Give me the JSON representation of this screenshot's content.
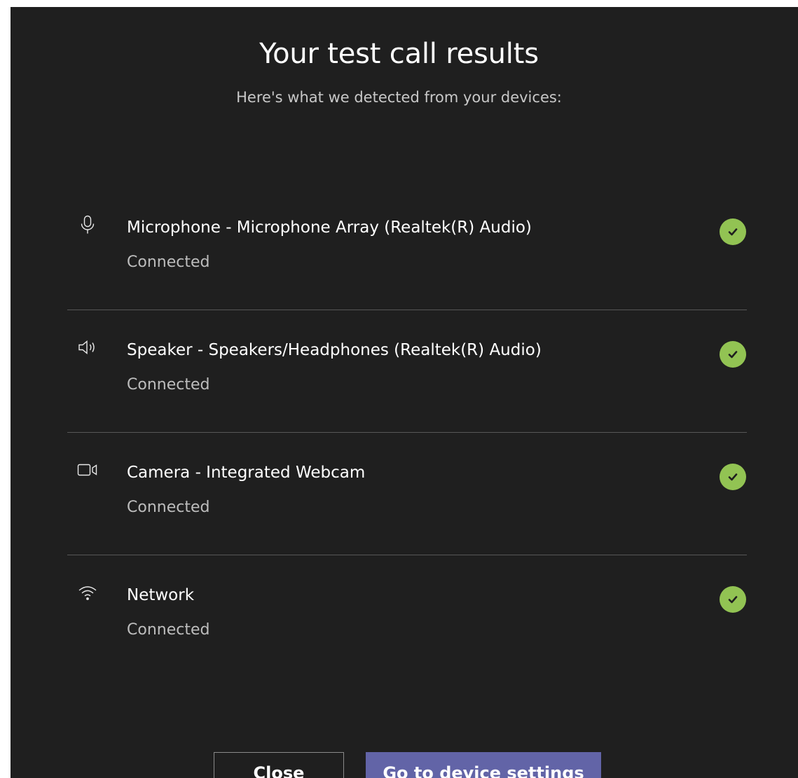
{
  "dialog": {
    "title": "Your test call results",
    "subtitle": "Here's what we detected from your devices:"
  },
  "devices": [
    {
      "name": "Microphone - Microphone Array (Realtek(R) Audio)",
      "status": "Connected",
      "icon": "microphone-icon"
    },
    {
      "name": "Speaker - Speakers/Headphones (Realtek(R) Audio)",
      "status": "Connected",
      "icon": "speaker-icon"
    },
    {
      "name": "Camera - Integrated Webcam",
      "status": "Connected",
      "icon": "camera-icon"
    },
    {
      "name": "Network",
      "status": "Connected",
      "icon": "wifi-icon"
    }
  ],
  "buttons": {
    "close_label": "Close",
    "settings_label": "Go to device settings"
  },
  "colors": {
    "background": "#1f1f1f",
    "success": "#92c353",
    "primary_button": "#6264a7",
    "divider": "#575757"
  }
}
